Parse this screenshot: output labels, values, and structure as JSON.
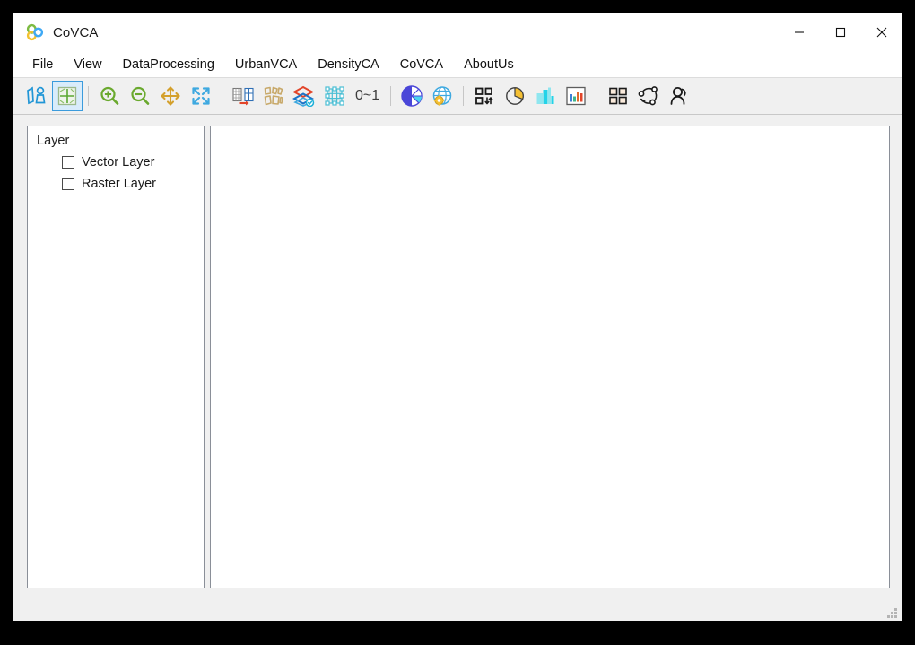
{
  "window": {
    "title": "CoVCA",
    "logo_icon": "covca-logo-icon",
    "controls": {
      "minimize_label": "Minimize",
      "maximize_label": "Maximize",
      "close_label": "Close"
    }
  },
  "menu": {
    "items": [
      {
        "label": "File",
        "name": "menu-item-file"
      },
      {
        "label": "View",
        "name": "menu-item-view"
      },
      {
        "label": "DataProcessing",
        "name": "menu-item-dataprocessing"
      },
      {
        "label": "UrbanVCA",
        "name": "menu-item-urbanvca"
      },
      {
        "label": "DensityCA",
        "name": "menu-item-densityca"
      },
      {
        "label": "CoVCA",
        "name": "menu-item-covca"
      },
      {
        "label": "AboutUs",
        "name": "menu-item-aboutus"
      }
    ]
  },
  "toolbar": {
    "items": [
      {
        "type": "button",
        "icon": "vector-shapes-icon",
        "title": "Open Vector Layer",
        "pressed": false
      },
      {
        "type": "button",
        "icon": "raster-grid-icon",
        "title": "Open Raster Layer",
        "pressed": true
      },
      {
        "type": "separator"
      },
      {
        "type": "button",
        "icon": "zoom-in-icon",
        "title": "Zoom In",
        "pressed": false
      },
      {
        "type": "button",
        "icon": "zoom-out-icon",
        "title": "Zoom Out",
        "pressed": false
      },
      {
        "type": "button",
        "icon": "pan-icon",
        "title": "Pan",
        "pressed": false
      },
      {
        "type": "button",
        "icon": "full-extent-icon",
        "title": "Full Extent",
        "pressed": false
      },
      {
        "type": "separator"
      },
      {
        "type": "button",
        "icon": "table-to-vector-icon",
        "title": "Attribute Table",
        "pressed": false
      },
      {
        "type": "button",
        "icon": "parcel-polygons-icon",
        "title": "Parcel Generation",
        "pressed": false
      },
      {
        "type": "button",
        "icon": "layers-stack-icon",
        "title": "Layer Overlay",
        "pressed": false
      },
      {
        "type": "button",
        "icon": "fishnet-grid-icon",
        "title": "Create Fishnet",
        "pressed": false
      },
      {
        "type": "text",
        "label": "0~1",
        "title": "Normalize 0~1",
        "name": "toolbar-normalize-label"
      },
      {
        "type": "separator"
      },
      {
        "type": "button",
        "icon": "sphere-split-icon",
        "title": "Land Use Classification",
        "pressed": false
      },
      {
        "type": "button",
        "icon": "globe-gear-icon",
        "title": "Simulation Settings",
        "pressed": false
      },
      {
        "type": "separator"
      },
      {
        "type": "button",
        "icon": "squares-sort-icon",
        "title": "Sort Blocks",
        "pressed": false
      },
      {
        "type": "button",
        "icon": "pie-chart-icon",
        "title": "Pie Chart",
        "pressed": false
      },
      {
        "type": "button",
        "icon": "bar-chart-cyan-icon",
        "title": "Bar Chart",
        "pressed": false
      },
      {
        "type": "button",
        "icon": "bar-chart-framed-icon",
        "title": "Statistics Chart",
        "pressed": false
      },
      {
        "type": "separator"
      },
      {
        "type": "button",
        "icon": "grid-four-squares-icon",
        "title": "Grid View",
        "pressed": false
      },
      {
        "type": "button",
        "icon": "network-nodes-icon",
        "title": "Transition Network",
        "pressed": false
      },
      {
        "type": "button",
        "icon": "user-icon",
        "title": "User",
        "pressed": false
      }
    ]
  },
  "layer_panel": {
    "title": "Layer",
    "layers": [
      {
        "label": "Vector Layer",
        "checked": false,
        "name": "layer-item-vector"
      },
      {
        "label": "Raster Layer",
        "checked": false,
        "name": "layer-item-raster"
      }
    ]
  },
  "map_canvas": {
    "content": ""
  },
  "status_bar": {
    "text": "",
    "grip_icon": "resize-grip-icon"
  },
  "colors": {
    "window_bg": "#ffffff",
    "chrome_bg": "#f0f0f0",
    "panel_border": "#8a8f98",
    "accent_blue": "#3b9bdc",
    "pressed_bg": "#d9ecfb",
    "logo_green": "#7dbb42",
    "logo_yellow": "#f2c230",
    "logo_blue": "#3fa9f5",
    "text": "#1a1a1a"
  }
}
